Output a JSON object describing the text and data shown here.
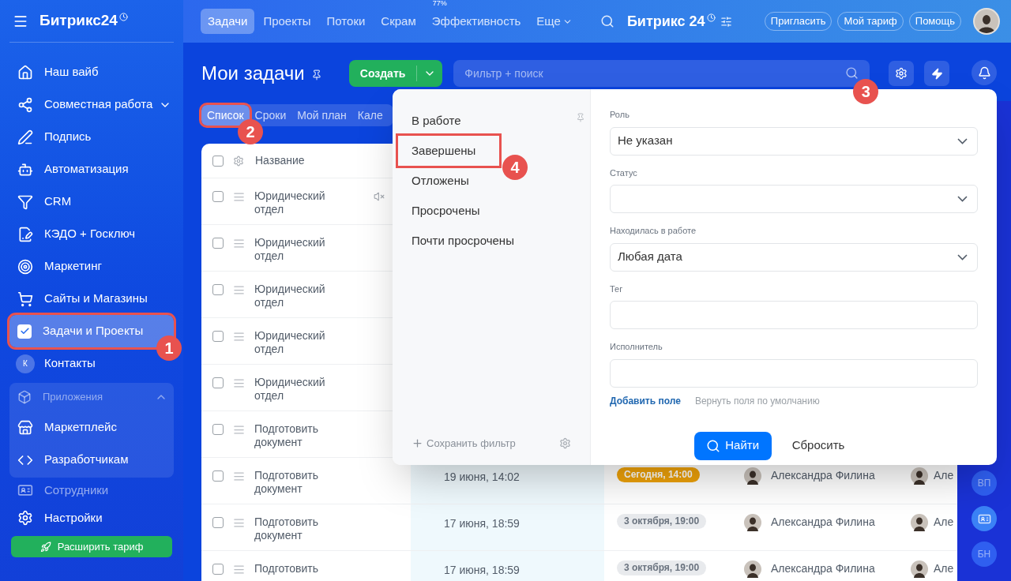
{
  "sidebar": {
    "logo": "Битрикс24",
    "items": [
      {
        "label": "Наш вайб",
        "selected": false
      },
      {
        "label": "Совместная работа",
        "selected": false,
        "has_chevron": true
      },
      {
        "label": "Подпись",
        "selected": false
      },
      {
        "label": "Автоматизация",
        "selected": false
      },
      {
        "label": "CRM",
        "selected": false
      },
      {
        "label": "КЭДО + Госключ",
        "selected": false
      },
      {
        "label": "Маркетинг",
        "selected": false
      },
      {
        "label": "Сайты и Магазины",
        "selected": false
      },
      {
        "label": "Задачи и Проекты",
        "selected": true,
        "callout": "1"
      },
      {
        "label": "Контакты",
        "selected": false,
        "avatar": "К"
      }
    ],
    "group": {
      "label": "Приложения",
      "expanded": true,
      "items": [
        {
          "label": "Маркетплейс"
        },
        {
          "label": "Разработчикам"
        }
      ]
    },
    "cut_item": "Сотрудники",
    "settings": "Настройки",
    "upgrade_button": "Расширить тариф"
  },
  "top_nav": {
    "tabs": [
      {
        "label": "Задачи",
        "selected": true
      },
      {
        "label": "Проекты",
        "selected": false
      },
      {
        "label": "Потоки",
        "selected": false
      },
      {
        "label": "Скрам",
        "selected": false
      },
      {
        "label": "Эффективность",
        "selected": false,
        "badge": "77%"
      },
      {
        "label": "Еще",
        "selected": false,
        "dropdown": true
      }
    ],
    "logo": "Битрикс 24",
    "buttons": [
      "Пригласить",
      "Мой тариф",
      "Помощь"
    ]
  },
  "page": {
    "title": "Мои задачи",
    "create_button": "Создать",
    "search": {
      "placeholder": "Фильтр + поиск",
      "callout": "3"
    },
    "views": [
      {
        "label": "Список",
        "selected": true,
        "callout": "2"
      },
      {
        "label": "Сроки",
        "selected": false
      },
      {
        "label": "Мой план",
        "selected": false
      },
      {
        "label": "Кале",
        "selected": false
      }
    ]
  },
  "table": {
    "columns": [
      "Название"
    ],
    "select_all_checked": false,
    "rows": [
      {
        "title": "Юридический отдел",
        "muted": true,
        "checked": false
      },
      {
        "title": "Юридический отдел",
        "muted": false,
        "checked": false
      },
      {
        "title": "Юридический отдел",
        "muted": false,
        "checked": false
      },
      {
        "title": "Юридический отдел",
        "muted": false,
        "checked": false
      },
      {
        "title": "Юридический отдел",
        "muted": false,
        "checked": false
      },
      {
        "title": "Подготовить документ",
        "muted": false,
        "checked": false
      },
      {
        "title": "Подготовить документ",
        "muted": false,
        "checked": false,
        "date": "19 июня, 14:02",
        "deadline": {
          "text": "Сегодня, 14:00",
          "kind": "today"
        },
        "person": "Александра Филина",
        "column_5": "Але"
      },
      {
        "title": "Подготовить документ",
        "muted": false,
        "checked": false,
        "date": "17 июня, 18:59",
        "deadline": {
          "text": "3 октября, 19:00",
          "kind": "future"
        },
        "person": "Александра Филина",
        "column_5": "Але"
      },
      {
        "title": "Подготовить",
        "muted": false,
        "checked": false,
        "date": "17 июня, 18:59",
        "deadline": {
          "text": "3 октября, 19:00",
          "kind": "future"
        },
        "person": "Александра Филина",
        "column_5": "Але"
      }
    ]
  },
  "right_strip": {
    "avatars": [
      {
        "initials": "ВП",
        "kind": "initials"
      },
      {
        "kind": "icon"
      },
      {
        "initials": "БН",
        "kind": "initials"
      }
    ]
  },
  "filter_popup": {
    "presets": [
      {
        "label": "В работе",
        "selected": false
      },
      {
        "label": "Завершены",
        "selected": false,
        "callout": "4"
      },
      {
        "label": "Отложены",
        "selected": false
      },
      {
        "label": "Просрочены",
        "selected": false
      },
      {
        "label": "Почти просрочены",
        "selected": false
      }
    ],
    "save_filter": "Сохранить фильтр",
    "fields": [
      {
        "label": "Роль",
        "kind": "select",
        "value": "Не указан"
      },
      {
        "label": "Статус",
        "kind": "select"
      },
      {
        "label": "Находилась в работе",
        "kind": "select",
        "value": "Любая дата"
      },
      {
        "label": "Тег",
        "kind": "input"
      },
      {
        "label": "Исполнитель",
        "kind": "input"
      }
    ],
    "add_field": "Добавить поле",
    "reset_fields": "Вернуть поля по умолчанию",
    "find_button": "Найти",
    "reset_button": "Сбросить"
  }
}
